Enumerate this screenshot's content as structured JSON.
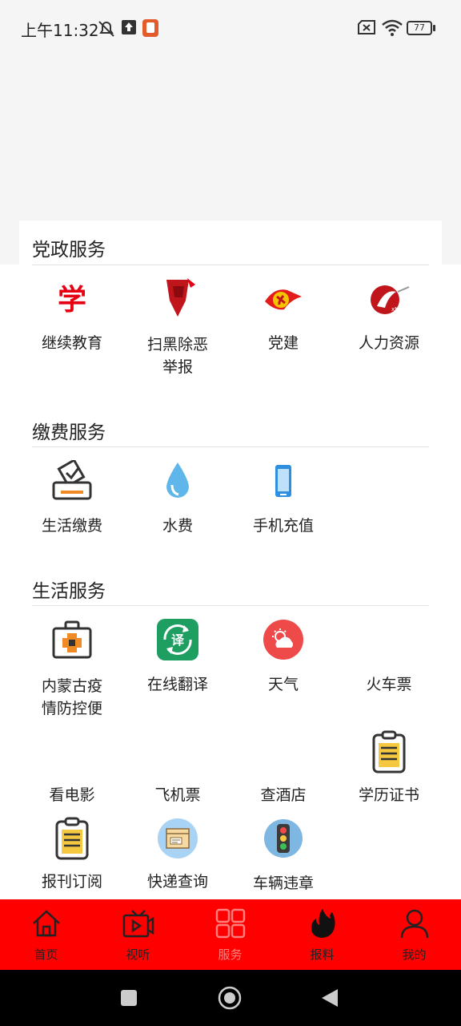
{
  "status_bar": {
    "time": "上午11:32",
    "battery": "77"
  },
  "sections": [
    {
      "title": "党政服务",
      "items": [
        {
          "label": "继续教育",
          "icon": "xue-logo-icon"
        },
        {
          "label": "扫黑除恶\n举报",
          "icon": "anti-crime-fist-icon"
        },
        {
          "label": "党建",
          "icon": "party-emblem-icon"
        },
        {
          "label": "人力资源",
          "icon": "hr-logo-icon"
        }
      ]
    },
    {
      "title": "缴费服务",
      "items": [
        {
          "label": "生活缴费",
          "icon": "ballot-box-icon"
        },
        {
          "label": "水费",
          "icon": "water-drop-icon"
        },
        {
          "label": "手机充值",
          "icon": "mobile-phone-icon"
        }
      ]
    },
    {
      "title": "生活服务",
      "items": [
        {
          "label": "内蒙古疫\n情防控便",
          "icon": "medical-kit-icon"
        },
        {
          "label": "在线翻译",
          "icon": "translate-icon"
        },
        {
          "label": "天气",
          "icon": "weather-icon"
        },
        {
          "label": "火车票",
          "icon": ""
        },
        {
          "label": "看电影",
          "icon": ""
        },
        {
          "label": "飞机票",
          "icon": ""
        },
        {
          "label": "查酒店",
          "icon": ""
        },
        {
          "label": "学历证书",
          "icon": "clipboard-icon"
        },
        {
          "label": "报刊订阅",
          "icon": "clipboard-icon"
        },
        {
          "label": "快递查询",
          "icon": "package-icon"
        },
        {
          "label": "车辆违章",
          "icon": "traffic-light-icon"
        }
      ]
    }
  ],
  "tab_bar": {
    "tabs": [
      {
        "label": "首页",
        "icon": "home-icon"
      },
      {
        "label": "视听",
        "icon": "video-icon"
      },
      {
        "label": "服务",
        "icon": "grid-icon",
        "active": true
      },
      {
        "label": "报料",
        "icon": "fire-icon"
      },
      {
        "label": "我的",
        "icon": "user-icon"
      }
    ]
  },
  "colors": {
    "tab_bar_bg": "#ff0000",
    "active_tab": "#ff7f7f",
    "divider": "#e3e3e3"
  }
}
